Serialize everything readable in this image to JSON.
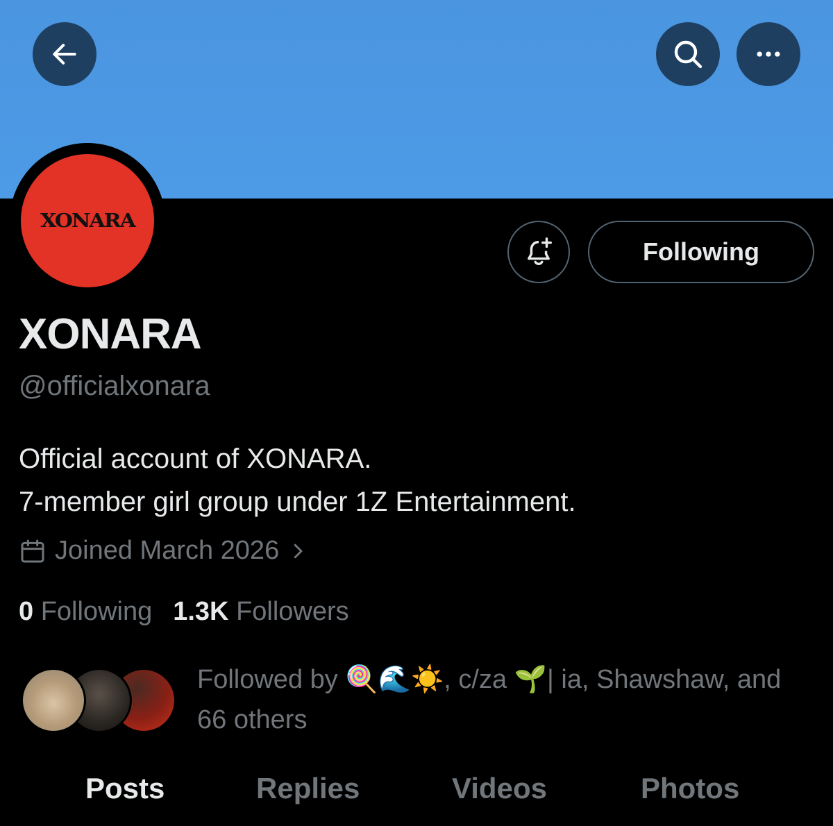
{
  "header": {
    "back_icon": "arrow-left-icon",
    "search_icon": "search-icon",
    "more_icon": "more-horizontal-icon",
    "banner_color": "#4b95e0"
  },
  "profile": {
    "avatar_logo_text": "XONARA",
    "avatar_color": "#e33226",
    "display_name": "XONARA",
    "handle": "@officialxonara",
    "bio": "Official account of XONARA.\n7-member girl group under 1Z Entertainment.",
    "joined": "Joined March 2026",
    "notify_icon": "bell-plus-icon",
    "follow_button_label": "Following"
  },
  "stats": {
    "following_count": "0",
    "following_label": "Following",
    "followers_count": "1.3K",
    "followers_label": "Followers"
  },
  "followed_by": {
    "text": "Followed by 🍭🌊☀️, c/za 🌱| ia, Shawshaw, and 66 others"
  },
  "tabs": [
    {
      "label": "Posts",
      "active": true
    },
    {
      "label": "Replies",
      "active": false
    },
    {
      "label": "Videos",
      "active": false
    },
    {
      "label": "Photos",
      "active": false
    }
  ]
}
